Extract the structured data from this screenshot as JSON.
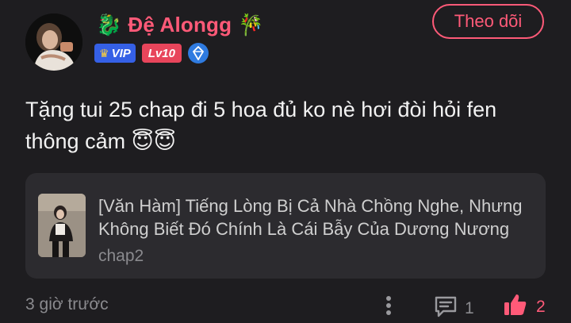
{
  "user": {
    "name": "Đệ Alongg",
    "emoji_left": "🐉",
    "emoji_right": "🎋",
    "vip_label": "VIP",
    "level_label": "Lv10"
  },
  "follow_button": {
    "label": "Theo dõi"
  },
  "comment": {
    "text": "Tặng tui 25 chap đi 5 hoa đủ ko nè hơi đòi hỏi fen thông cảm 😇😇"
  },
  "linked_story": {
    "title": "[Văn Hàm] Tiếng Lòng Bị Cả Nhà Chồng Nghe, Nhưng Không Biết Đó Chính Là Cái Bẫy Của Dương Nương",
    "chapter": "chap2"
  },
  "footer": {
    "time": "3 giờ trước",
    "reply_count": "1",
    "like_count": "2"
  },
  "colors": {
    "background": "#1e1d20",
    "accent": "#ff5a78",
    "card": "#2c2b2f",
    "muted": "#8a8a8e"
  },
  "icons": [
    "avatar",
    "crown-icon",
    "diamond-icon",
    "more-icon",
    "comment-icon",
    "thumbs-up-icon"
  ]
}
